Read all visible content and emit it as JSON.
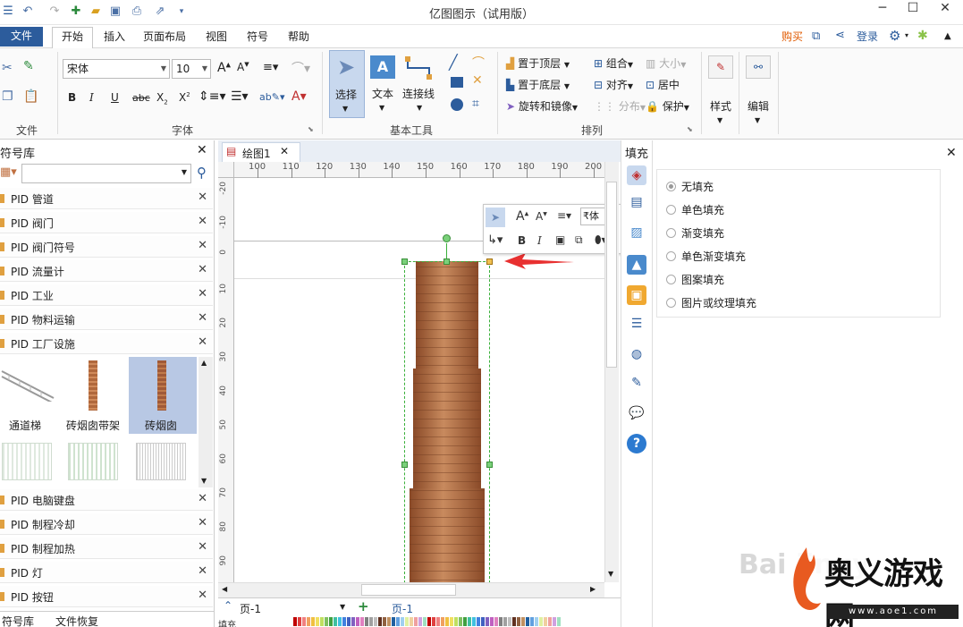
{
  "app": {
    "title": "亿图图示（试用版）"
  },
  "window": {
    "minimize": "─",
    "maximize": "☐",
    "close": "✕"
  },
  "menu": {
    "file": "文件",
    "tabs": [
      "开始",
      "插入",
      "页面布局",
      "视图",
      "符号",
      "帮助"
    ],
    "right": {
      "buy": "购买",
      "login": "登录"
    }
  },
  "ribbon": {
    "groups": {
      "file": "文件",
      "font": "字体",
      "basic_tools": "基本工具",
      "arrange": "排列"
    },
    "font": {
      "family": "宋体",
      "size": "10"
    },
    "basic_tools": {
      "select": "选择",
      "text": "文本",
      "connector": "连接线"
    },
    "arrange": {
      "bring_front": "置于顶层",
      "send_back": "置于底层",
      "rotate_mirror": "旋转和镜像",
      "group": "组合",
      "align": "对齐",
      "distribute": "分布",
      "size": "大小",
      "center": "居中",
      "protect": "保护"
    },
    "style": "样式",
    "edit": "编辑"
  },
  "symbol_library": {
    "title": "符号库",
    "search_placeholder": "",
    "categories_top": [
      "PID 管道",
      "PID 阀门",
      "PID 阀门符号",
      "PID 流量计",
      "PID 工业",
      "PID 物料运输",
      "PID 工厂设施"
    ],
    "shapes": [
      "通道梯",
      "砖烟囱带架",
      "砖烟囱"
    ],
    "categories_bottom": [
      "PID 电脑键盘",
      "PID 制程冷却",
      "PID 制程加热",
      "PID 灯",
      "PID 按钮"
    ],
    "bottom_tabs": [
      "符号库",
      "文件恢复"
    ]
  },
  "document": {
    "tab": "绘图1",
    "page_tab": "页-1",
    "page_tab_active": "页-1",
    "ruler_h": [
      "100",
      "110",
      "120",
      "130",
      "140",
      "150",
      "160",
      "170",
      "180",
      "190",
      "200"
    ],
    "ruler_v": [
      "-20",
      "-10",
      "0",
      "10",
      "20",
      "30",
      "40",
      "50",
      "60",
      "70",
      "80",
      "90"
    ]
  },
  "mini_toolbar": {
    "font": "₹体"
  },
  "fill_panel": {
    "title": "填充",
    "options": [
      "无填充",
      "单色填充",
      "渐变填充",
      "单色渐变填充",
      "图案填充",
      "图片或纹理填充"
    ],
    "selected": "无填充"
  },
  "status": {
    "fill_label": "填充"
  },
  "watermark": {
    "baidu": "Bai jingy",
    "site": "奥义游戏网",
    "url": "www.aoe1.com"
  },
  "colors": {
    "accent": "#2c5c9c",
    "chimney": "#a0603a",
    "arrow": "#e83030"
  }
}
